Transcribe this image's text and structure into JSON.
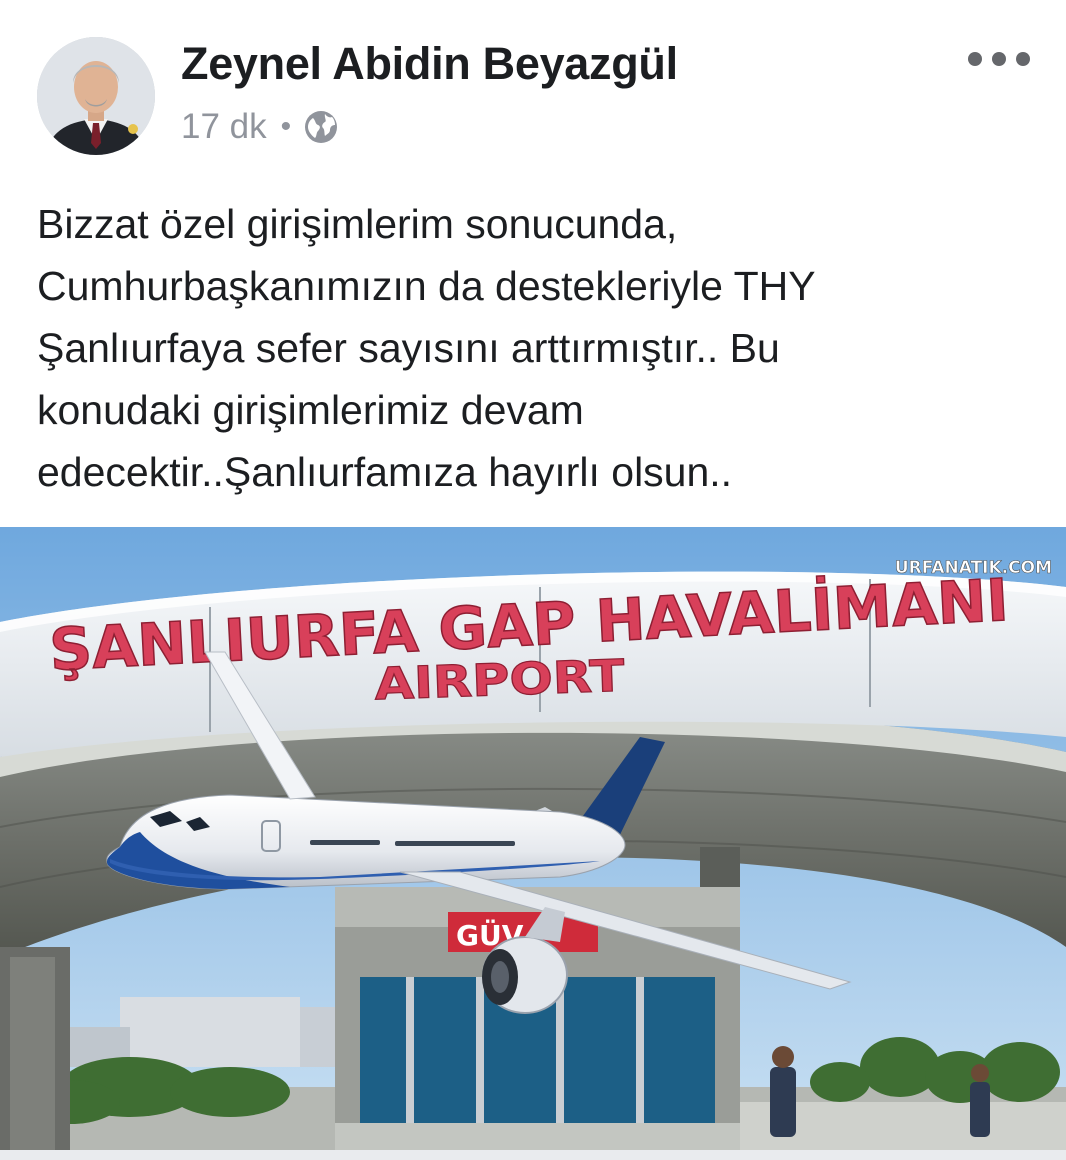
{
  "post": {
    "author_name": "Zeynel Abidin Beyazgül",
    "timestamp": "17 dk",
    "separator": "•",
    "privacy_icon": "globe-icon",
    "more_icon": "more-options-icon",
    "text": "Bizzat özel girişimlerim sonucunda,\nCumhurbaşkanımızın da destekleriyle THY\nŞanlıurfaya sefer sayısını arttırmıştır.. Bu\nkonudaki girişimlerimiz devam\nedecektir..Şanlıurfamıza hayırlı olsun..",
    "photo": {
      "sign_main": "ŞANLIURFA GAP HAVALİMANI",
      "sign_sub": "AIRPORT",
      "watermark": "URFANATIK.COM",
      "booth_sign": "GÜV"
    }
  },
  "colors": {
    "text_primary": "#1c1e21",
    "text_secondary": "#90949c",
    "sign_letters": "#d8405a",
    "sky": "#8fbce6"
  }
}
